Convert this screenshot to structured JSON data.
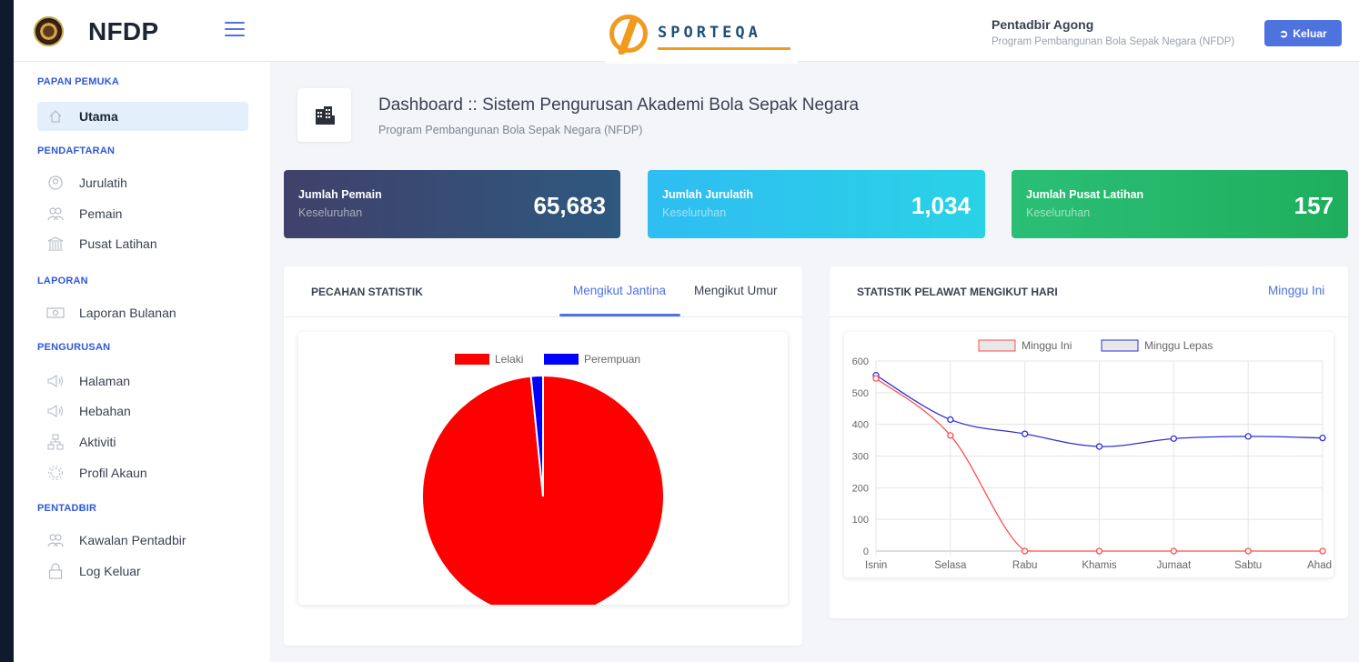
{
  "header": {
    "brand": "NFDP",
    "sponsor": "SPORTEQA",
    "user_name": "Pentadbir Agong",
    "user_program": "Program Pembangunan Bola Sepak Negara (NFDP)",
    "logout_label": "Keluar"
  },
  "sidebar": {
    "sections": [
      {
        "title": "PAPAN PEMUKA",
        "items": [
          {
            "label": "Utama",
            "icon": "home-icon",
            "active": true
          }
        ]
      },
      {
        "title": "PENDAFTARAN",
        "items": [
          {
            "label": "Jurulatih",
            "icon": "user-icon"
          },
          {
            "label": "Pemain",
            "icon": "users-icon"
          },
          {
            "label": "Pusat Latihan",
            "icon": "building-icon"
          }
        ]
      },
      {
        "title": "LAPORAN",
        "items": [
          {
            "label": "Laporan Bulanan",
            "icon": "money-icon"
          }
        ]
      },
      {
        "title": "PENGURUSAN",
        "items": [
          {
            "label": "Halaman",
            "icon": "megaphone-icon"
          },
          {
            "label": "Hebahan",
            "icon": "megaphone-icon"
          },
          {
            "label": "Aktiviti",
            "icon": "sitemap-icon"
          },
          {
            "label": "Profil Akaun",
            "icon": "gear-icon"
          }
        ]
      },
      {
        "title": "PENTADBIR",
        "items": [
          {
            "label": "Kawalan Pentadbir",
            "icon": "users-icon"
          },
          {
            "label": "Log Keluar",
            "icon": "lock-icon"
          }
        ]
      }
    ]
  },
  "page": {
    "title": "Dashboard :: Sistem Pengurusan Akademi Bola Sepak Negara",
    "subtitle": "Program Pembangunan Bola Sepak Negara (NFDP)"
  },
  "stats": [
    {
      "title": "Jumlah Pemain",
      "sub": "Keseluruhan",
      "value": "65,683"
    },
    {
      "title": "Jumlah Jurulatih",
      "sub": "Keseluruhan",
      "value": "1,034"
    },
    {
      "title": "Jumlah Pusat Latihan",
      "sub": "Keseluruhan",
      "value": "157"
    }
  ],
  "panel_stat": {
    "title": "PECAHAN STATISTIK",
    "tab_gender": "Mengikut Jantina",
    "tab_age": "Mengikut Umur"
  },
  "panel_visitor": {
    "title": "STATISTIK PELAWAT MENGIKUT HARI",
    "link": "Minggu Ini"
  },
  "chart_data": [
    {
      "type": "pie",
      "legend": [
        "Lelaki",
        "Perempuan"
      ],
      "values": [
        98.4,
        1.6
      ],
      "colors": [
        "#ff0000",
        "#0000ff"
      ],
      "legend_position": "top"
    },
    {
      "type": "line",
      "categories": [
        "Isnin",
        "Selasa",
        "Rabu",
        "Khamis",
        "Jumaat",
        "Sabtu",
        "Ahad"
      ],
      "series": [
        {
          "name": "Minggu Ini",
          "values": [
            545,
            365,
            0,
            0,
            0,
            0,
            0
          ],
          "color": "#ff4d4d"
        },
        {
          "name": "Minggu Lepas",
          "values": [
            555,
            415,
            370,
            330,
            355,
            362,
            357
          ],
          "color": "#2f2fd8"
        }
      ],
      "ylim": [
        0,
        600
      ],
      "yticks": [
        "600",
        "500",
        "400",
        "300",
        "200",
        "100",
        "0"
      ],
      "grid": true,
      "legend_position": "top"
    }
  ]
}
